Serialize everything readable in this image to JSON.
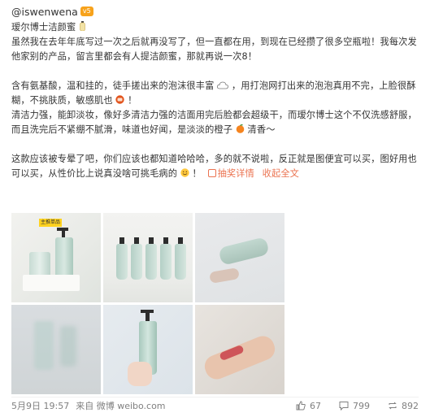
{
  "post": {
    "author": "@iswenwena",
    "vip_badge": "v5",
    "title": "瑷尔博士洁颜蜜",
    "paragraphs": {
      "p1": "虽然我在去年年底写过一次之后就再没写了，但一直都在用，到现在已经攒了很多空瓶啦！我每次发他家别的产品，留言里都会有人提洁颜蜜，那就再说一次8！",
      "p2a": "含有氨基酸，温和挂的，徒手搓出来的泡沫很丰富",
      "p2b": "，用打泡网打出来的泡泡真用不完，上脸很酥糊，不挑肤质，敏感肌也",
      "p2c": "！",
      "p3a": "清洁力强，能卸淡妆，像好多清洁力强的洁面用完后脸都会超级干，而瑷尔博士这个不仅洗感舒服，而且洗完后不紧绷不腻滑，味道也好闻，是淡淡的橙子",
      "p3b": "清香～",
      "p4a": "这款应该被专晕了吧，你们应该也都知道哈哈哈，多的就不说啦，反正就是图便宜可以买，图好用也可以买，从性价比上说真没啥可挑毛病的",
      "p4b": "！"
    },
    "lottery_link": "抽奖详情",
    "collapse_link": "收起全文",
    "sticker_text": "主推单品",
    "timestamp": "5月9日 19:57",
    "source": "来自 微博 weibo.com",
    "stats": {
      "likes": "67",
      "comments": "799",
      "reposts": "892"
    }
  },
  "icons": {
    "vip": "vip-badge-icon",
    "title_emoji": "bottle-emoji-icon",
    "cloud": "cloud-emoji-icon",
    "ok": "ok-emoji-icon",
    "orange": "orange-emoji-icon",
    "smile": "smile-emoji-icon",
    "like": "thumbs-up-icon",
    "comment": "comment-icon",
    "repost": "repost-icon"
  },
  "colors": {
    "link": "#eb7350",
    "text": "#333333",
    "meta": "#808080",
    "badge": "#f7a21b"
  }
}
